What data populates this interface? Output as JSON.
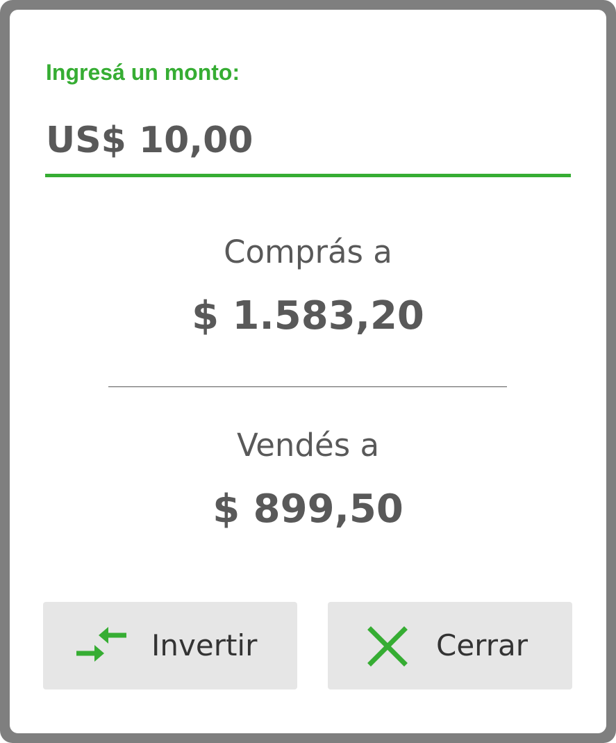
{
  "converter": {
    "amount_label": "Ingresá un monto:",
    "amount_value": "US$ 10,00",
    "buy_label": "Comprás a",
    "buy_value": "$ 1.583,20",
    "sell_label": "Vendés a",
    "sell_value": "$ 899,50"
  },
  "buttons": {
    "invert_label": "Invertir",
    "close_label": "Cerrar"
  },
  "icons": {
    "invert": "swap-arrows-icon",
    "close": "close-icon"
  },
  "colors": {
    "accent": "#36ad33",
    "text": "#595959",
    "frame": "#7f7f7f",
    "button_bg": "#e6e6e6"
  }
}
